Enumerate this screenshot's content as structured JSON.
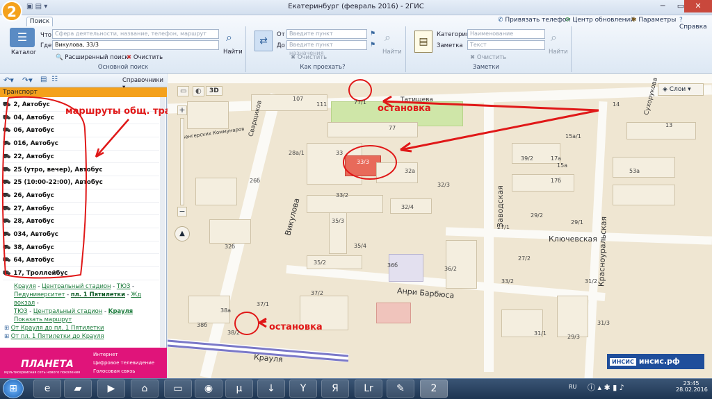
{
  "window": {
    "title": "Екатеринбург (февраль 2016) - 2ГИС",
    "logo": "2"
  },
  "ribbon": {
    "tab": "Поиск",
    "links": [
      "Привязать телефон",
      "Центр обновлений",
      "Параметры",
      "Справка"
    ],
    "catalog": "Каталог",
    "search": {
      "what_label": "Что",
      "what_placeholder": "Сфера деятельности, название, телефон, маршрут",
      "where_label": "Где",
      "where_value": "Викулова, 33/3",
      "find": "Найти",
      "advanced": "Расширенный поиск",
      "clear": "Очистить",
      "group_label": "Основной поиск"
    },
    "route": {
      "from_label": "От",
      "from_placeholder": "Введите пункт отправления",
      "to_label": "До",
      "to_placeholder": "Введите пункт назначения",
      "clear": "Очистить",
      "find": "Найти",
      "group_label": "Как проехать?"
    },
    "notes": {
      "category_label": "Категория",
      "category_placeholder": "Наименование",
      "note_label": "Заметка",
      "note_placeholder": "Текст",
      "clear": "Очистить",
      "find": "Найти",
      "group_label": "Заметки"
    }
  },
  "sidebar": {
    "directories": "Справочники",
    "header": "Транспорт",
    "routes": [
      "2, Автобус",
      "04, Автобус",
      "06, Автобус",
      "016, Автобус",
      "22, Автобус",
      "25 (утро, вечер), Автобус",
      "25 (10:00-22:00), Автобус",
      "26, Автобус",
      "27, Автобус",
      "28, Автобус",
      "034, Автобус",
      "38, Автобус",
      "64, Автобус",
      "17, Троллейбус"
    ],
    "trolley_route": {
      "stops_line1": [
        "Крауля",
        "Центральный стадион",
        "ТЮЗ",
        "Педуниверситет"
      ],
      "highlight": "пл. 1 Пятилетки",
      "stops_line2": [
        "Жд вокзал",
        "ТЮЗ",
        "Центральный стадион",
        "Крауля"
      ],
      "show_route": "Показать маршрут",
      "dir1": "От Крауля до пл. 1 Пятилетки",
      "dir2": "От пл. 1 Пятилетки до Крауля"
    },
    "annotation": "маршруты общ. транс.",
    "banner": {
      "brand": "ПЛАНЕТА",
      "tagline": "мультисервисная сеть нового поколения",
      "services": [
        "Интернет",
        "Цифровое телевидение",
        "Голосовая связь"
      ]
    }
  },
  "map": {
    "layers": "Слои",
    "mode_3d": "3D",
    "streets": [
      "Татищева",
      "Викулова",
      "Заводская",
      "Ключевская",
      "Анри Барбюса",
      "Красноуральская",
      "Крауля",
      "Сухорукова",
      "Сварщиков",
      "Венгерских Коммунаров"
    ],
    "house_numbers": [
      "77/1",
      "77",
      "33",
      "33/3",
      "32a",
      "33/2",
      "32/4",
      "32/3",
      "35/3",
      "35/4",
      "36б",
      "36/2",
      "37/1",
      "37/2",
      "38a",
      "38б",
      "38/2",
      "107",
      "111",
      "28a/1",
      "26б",
      "32б",
      "35/2",
      "39/2",
      "29/2",
      "29/1",
      "15a/1",
      "15a",
      "17a",
      "17б",
      "53a",
      "33/2",
      "27/1",
      "29/3",
      "27/2",
      "31/1",
      "31/2",
      "31/3",
      "13",
      "14"
    ],
    "annotation_stop": "остановка",
    "ad": {
      "logo": "ИНСИС",
      "text": "инсис.рф"
    },
    "colors": {
      "annotation": "#e01818",
      "tram": "#7a78c8"
    }
  },
  "taskbar": {
    "lang": "RU",
    "time": "23:45",
    "date": "28.02.2016"
  }
}
